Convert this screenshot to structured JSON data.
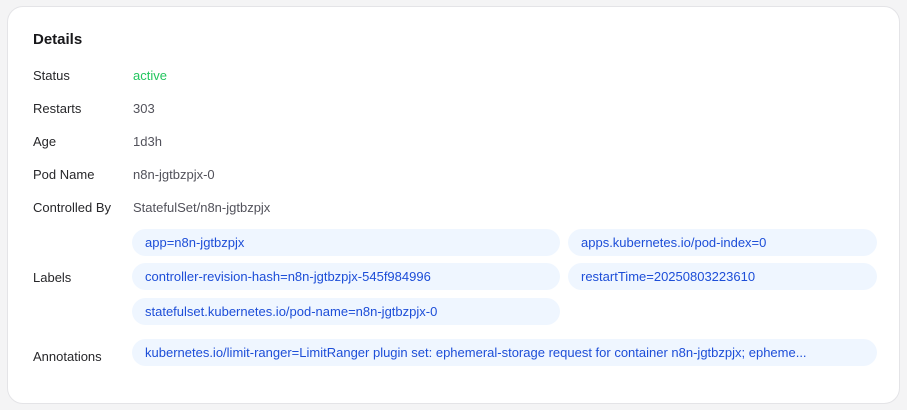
{
  "details": {
    "title": "Details",
    "status": {
      "label": "Status",
      "value": "active",
      "color": "#22c55e"
    },
    "restarts": {
      "label": "Restarts",
      "value": "303"
    },
    "age": {
      "label": "Age",
      "value": "1d3h"
    },
    "pod_name": {
      "label": "Pod Name",
      "value": "n8n-jgtbzpjx-0"
    },
    "controlled_by": {
      "label": "Controlled By",
      "value": "StatefulSet/n8n-jgtbzpjx"
    },
    "labels": {
      "label": "Labels",
      "items": [
        "app=n8n-jgtbzpjx",
        "apps.kubernetes.io/pod-index=0",
        "controller-revision-hash=n8n-jgtbzpjx-545f984996",
        "restartTime=20250803223610",
        "statefulset.kubernetes.io/pod-name=n8n-jgtbzpjx-0"
      ]
    },
    "annotations": {
      "label": "Annotations",
      "items": [
        "kubernetes.io/limit-ranger=LimitRanger plugin set: ephemeral-storage request for container n8n-jgtbzpjx; epheme..."
      ]
    }
  }
}
